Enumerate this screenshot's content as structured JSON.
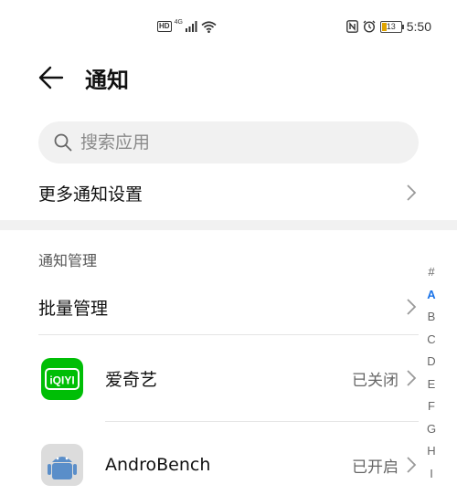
{
  "status_bar": {
    "hd": "HD",
    "network": "4G",
    "battery": "13",
    "time": "5:50"
  },
  "header": {
    "title": "通知"
  },
  "search": {
    "placeholder": "搜索应用"
  },
  "more_settings": {
    "label": "更多通知设置"
  },
  "section": {
    "title": "通知管理"
  },
  "batch": {
    "label": "批量管理"
  },
  "apps": [
    {
      "name": "爱奇艺",
      "status": "已关闭",
      "icon": "iqiyi-icon",
      "icon_text": "iQIYI"
    },
    {
      "name": "AndroBench",
      "status": "已开启",
      "icon": "androbench-icon"
    }
  ],
  "index": [
    "#",
    "A",
    "B",
    "C",
    "D",
    "E",
    "F",
    "G",
    "H",
    "I"
  ],
  "index_active": "A",
  "colors": {
    "accent": "#1a73e8",
    "iqiyi_green": "#00be06"
  }
}
